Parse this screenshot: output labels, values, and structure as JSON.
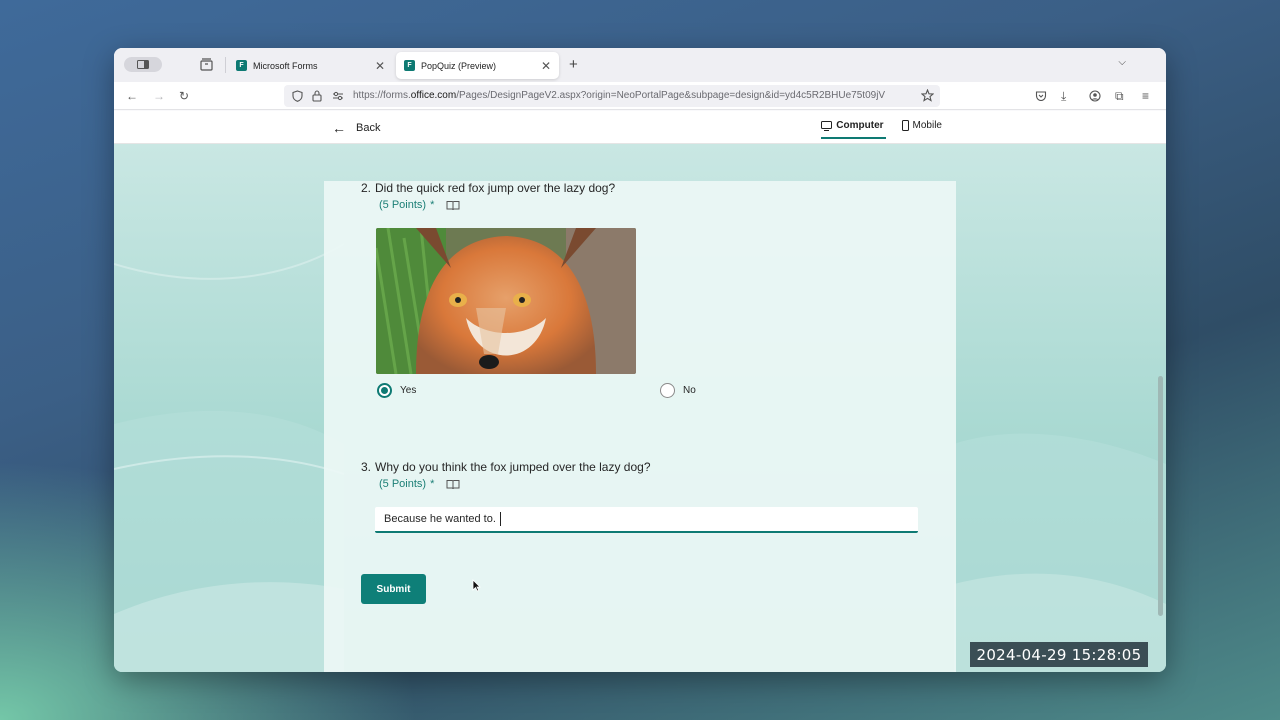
{
  "browser": {
    "tabs": [
      {
        "title": "Microsoft Forms",
        "active": false
      },
      {
        "title": "PopQuiz (Preview)",
        "active": true
      }
    ],
    "url": {
      "prefix": "https://forms.",
      "domain": "office.com",
      "path": "/Pages/DesignPageV2.aspx?origin=NeoPortalPage&subpage=design&id=yd4c5R2BHUe75t09jV"
    }
  },
  "forms_header": {
    "back_label": "Back",
    "view_computer": "Computer",
    "view_mobile": "Mobile",
    "selected_view": "Computer"
  },
  "questions": [
    {
      "number": "2.",
      "text": "Did the quick red fox jump over the lazy dog?",
      "points": "(5 Points)",
      "required_mark": "*",
      "options": [
        {
          "label": "Yes",
          "selected": true
        },
        {
          "label": "No",
          "selected": false
        }
      ]
    },
    {
      "number": "3.",
      "text": "Why do you think the fox jumped over the lazy dog?",
      "points": "(5 Points)",
      "required_mark": "*",
      "answer": "Because he wanted to."
    }
  ],
  "submit_label": "Submit",
  "timestamp": "2024-04-29  15:28:05",
  "colors": {
    "accent": "#0e7a73",
    "points_text": "#1c7f76",
    "content_bg": "#a9d9d2"
  }
}
